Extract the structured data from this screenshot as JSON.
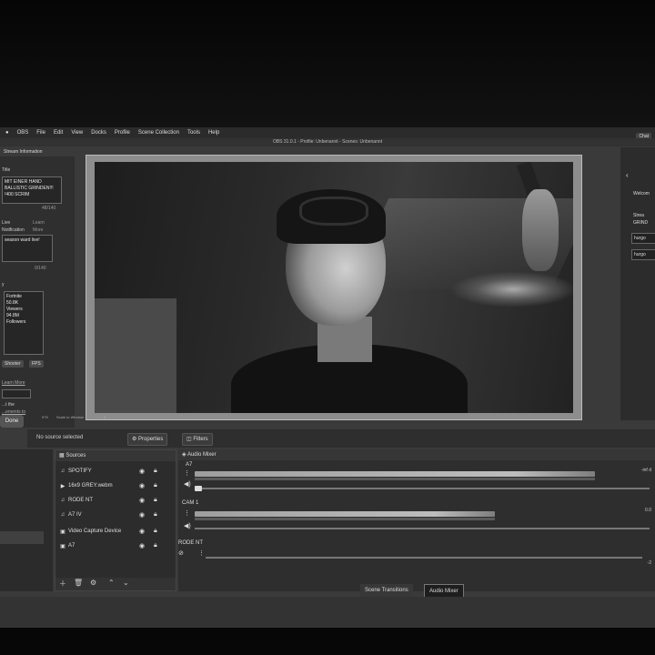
{
  "menubar": {
    "apple": "●",
    "items": [
      "OBS",
      "File",
      "Edit",
      "View",
      "Docks",
      "Profile",
      "Scene Collection",
      "Tools",
      "Help"
    ]
  },
  "titlebar": {
    "title": "OBS 31.0.1 - Profile: Unbenannt - Scenes: Unbenannt"
  },
  "chat_tab": "Chat",
  "left_panel": {
    "header": "Stream Information",
    "title_label": "Title",
    "title_value": "MIT EINER HAND BALLISTIC GRINDEN!!! !400 SCRIM",
    "title_count": "48/140",
    "live_label": "Live",
    "notification_label": "Notification",
    "learn_label": "Learn",
    "more_label": "More",
    "notif_value": "season ward live!",
    "notif_count": "0/140",
    "category_label": "y",
    "game": "Fortnite",
    "viewers_count": "50.8K",
    "viewers_label": "Viewers",
    "followers_count": "94.8M",
    "followers_label": "Followers",
    "tag_shooter": "Shooter",
    "tag_fps": "FPS",
    "learn_more": "Learn More",
    "agree_line1": "...t the",
    "agree_line2": "...ements to",
    "done": "Done"
  },
  "status_row": {
    "left": "979",
    "scale": "Scale to Window",
    "dropdown": "▾"
  },
  "props_bar": {
    "no_source": "No source selected",
    "properties": "Properties",
    "filters": "Filters"
  },
  "sources": {
    "title": "Sources",
    "items": [
      {
        "icon": "♫",
        "name": "SPOTIFY"
      },
      {
        "icon": "▶",
        "name": "16x9 GREY.webm"
      },
      {
        "icon": "♫",
        "name": "RODE NT"
      },
      {
        "icon": "♫",
        "name": "A7 IV"
      },
      {
        "icon": "▣",
        "name": "Video Capture Device"
      },
      {
        "icon": "▣",
        "name": "A7"
      }
    ]
  },
  "mixer": {
    "title": "Audio Mixer",
    "channels": [
      {
        "name": "A7",
        "db": "-inf d"
      },
      {
        "name": "CAM 1",
        "db": "0.0"
      },
      {
        "name": "RODE NT",
        "db": "-2"
      }
    ]
  },
  "bottom_tabs": {
    "transitions": "Scene Transitions",
    "mixer": "Audio Mixer"
  },
  "right_panel": {
    "arrow": "‹",
    "welcome": "Welcom",
    "stream": "Strea",
    "grind": "GRIND",
    "input1": "hurgo",
    "input2": "hurgo"
  },
  "colors": {
    "panel": "#2e2e2e",
    "meter": "#bdbdbd",
    "accent": "#dcdcdc"
  }
}
